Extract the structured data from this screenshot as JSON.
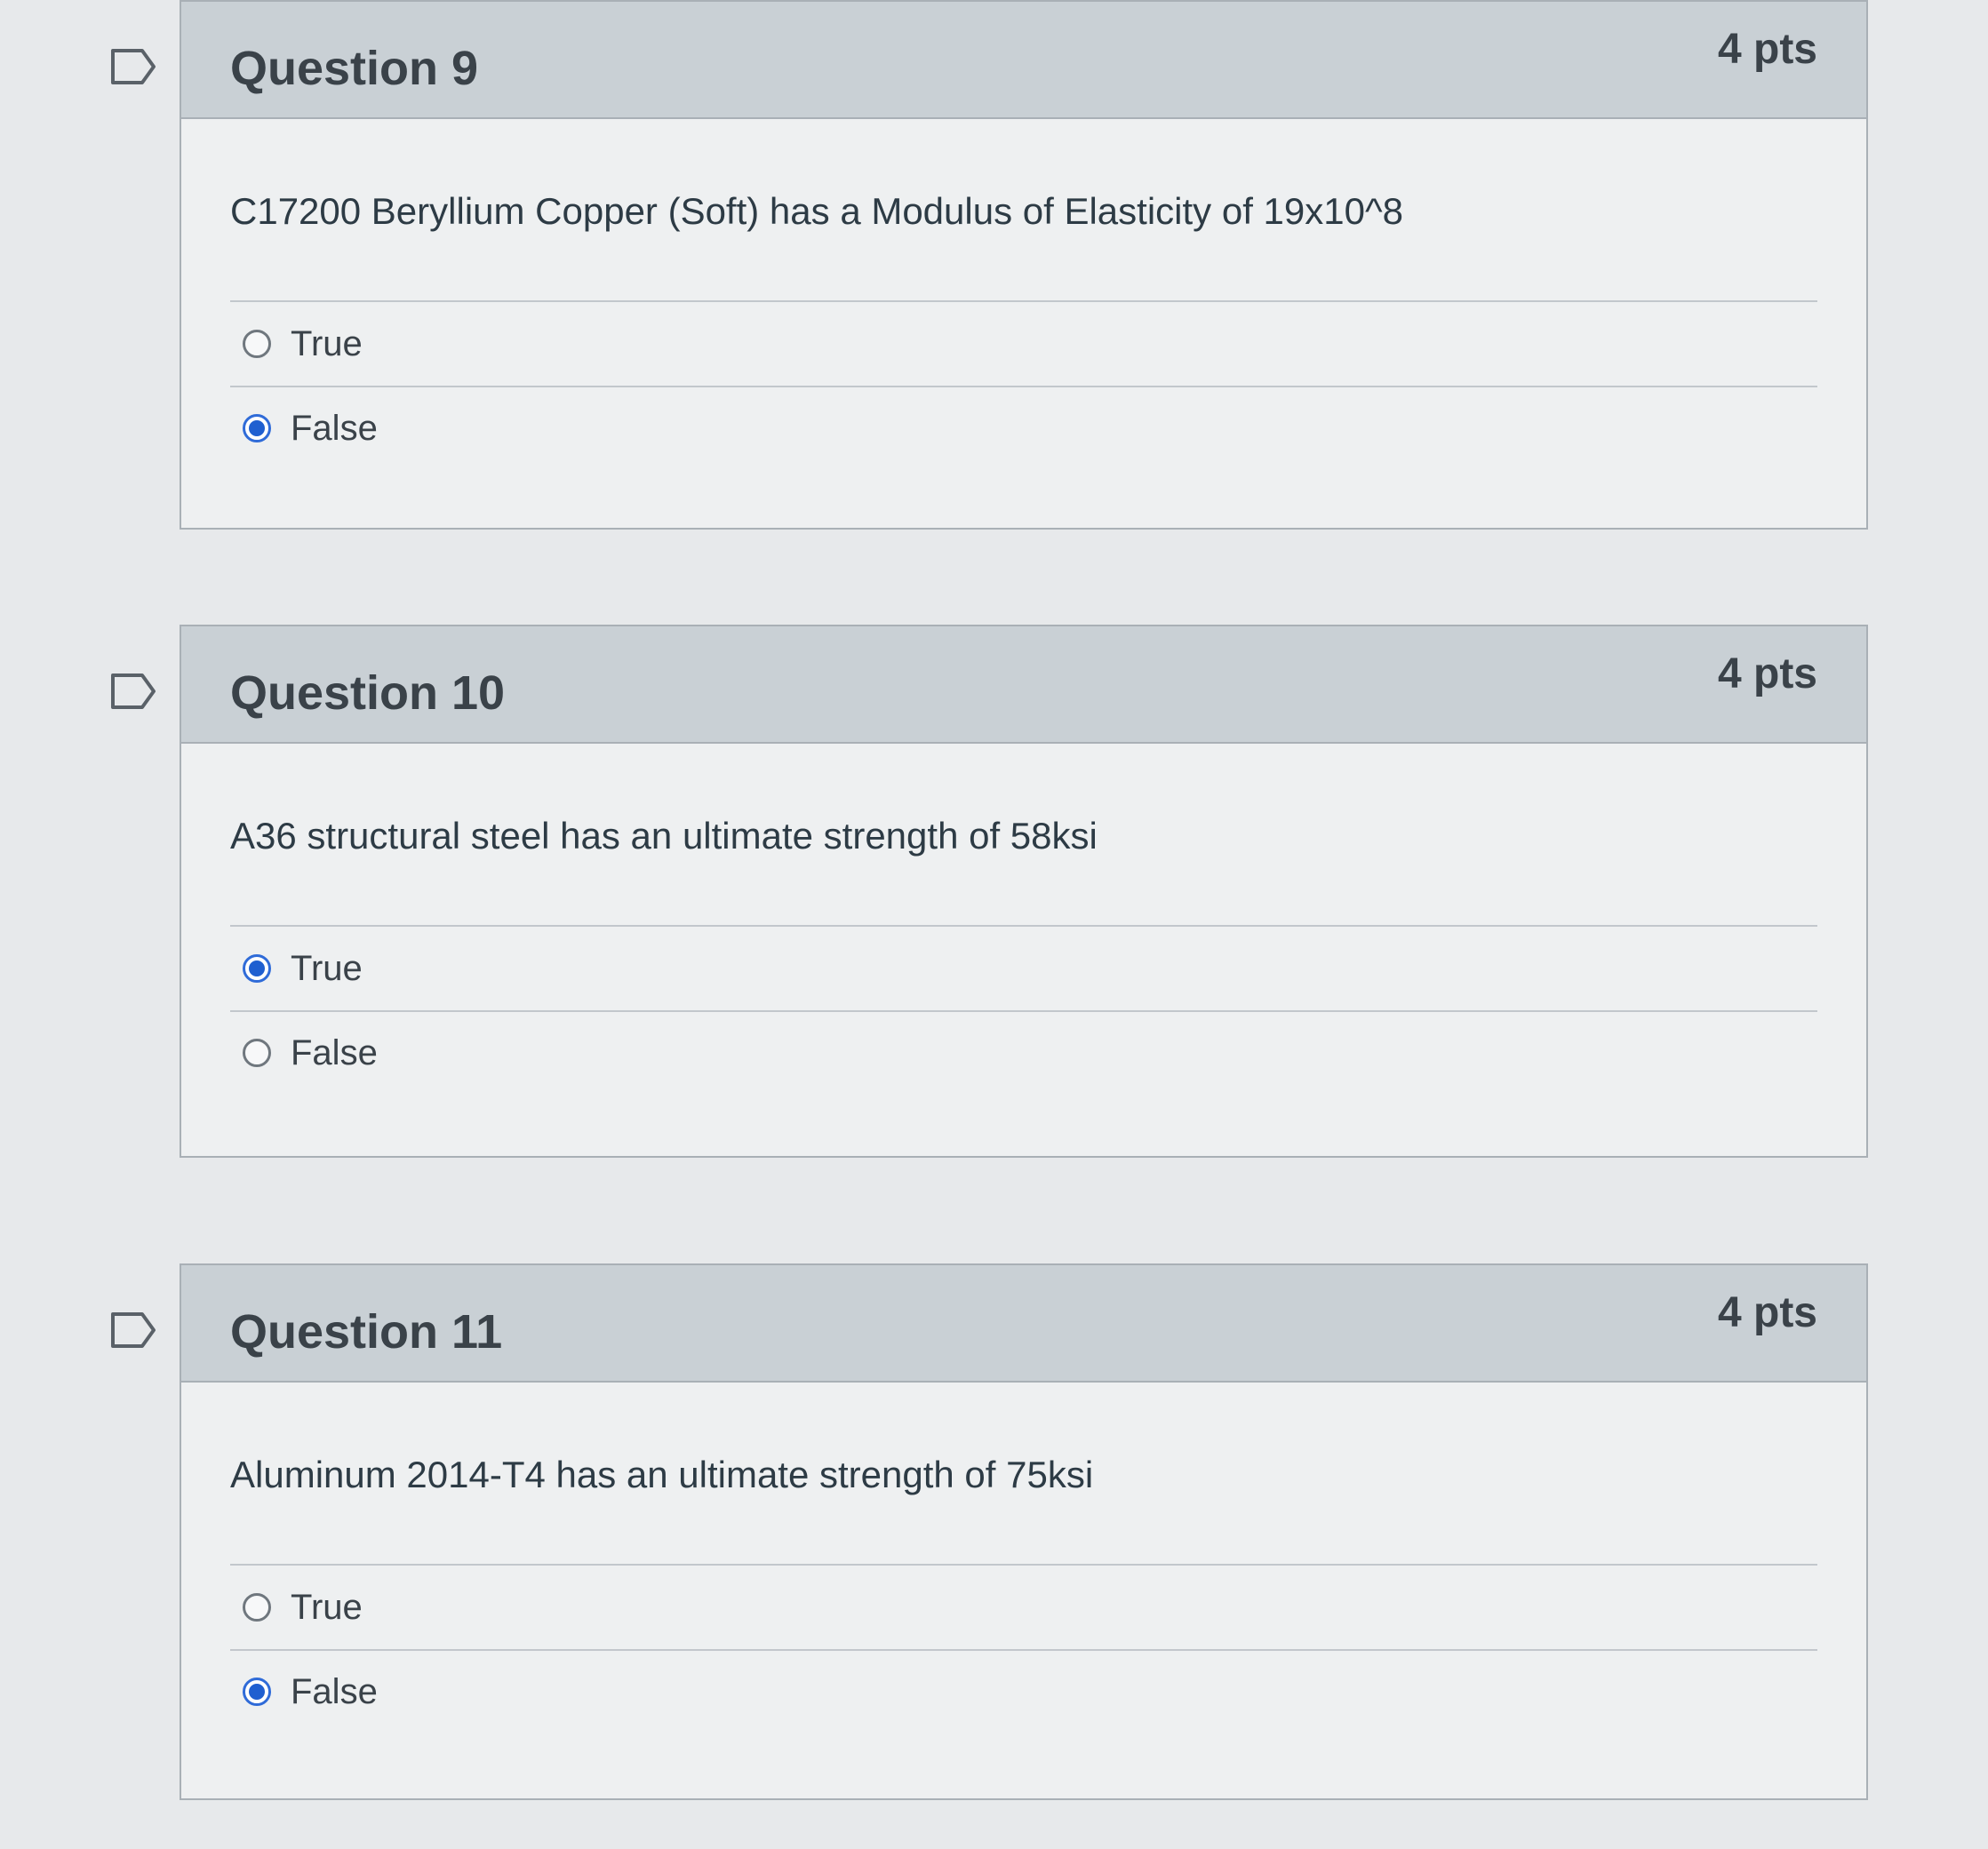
{
  "questions": [
    {
      "title": "Question 9",
      "points": "4 pts",
      "text": "C17200 Beryllium Copper (Soft) has a Modulus of Elasticity of 19x10^8",
      "answers": [
        {
          "label": "True",
          "selected": false
        },
        {
          "label": "False",
          "selected": true
        }
      ]
    },
    {
      "title": "Question 10",
      "points": "4 pts",
      "text": "A36 structural steel has an ultimate strength of 58ksi",
      "answers": [
        {
          "label": "True",
          "selected": true
        },
        {
          "label": "False",
          "selected": false
        }
      ]
    },
    {
      "title": "Question 11",
      "points": "4 pts",
      "text": "Aluminum 2014-T4 has an ultimate strength of 75ksi",
      "answers": [
        {
          "label": "True",
          "selected": false
        },
        {
          "label": "False",
          "selected": true
        }
      ]
    }
  ],
  "icons": {
    "flag": "flag-outline-icon",
    "radio_selected": "radio-selected-icon",
    "radio_unselected": "radio-unselected-icon"
  },
  "colors": {
    "header_bg": "#c9d0d5",
    "body_bg": "#eef0f1",
    "radio_selected": "#1f5fd0"
  }
}
